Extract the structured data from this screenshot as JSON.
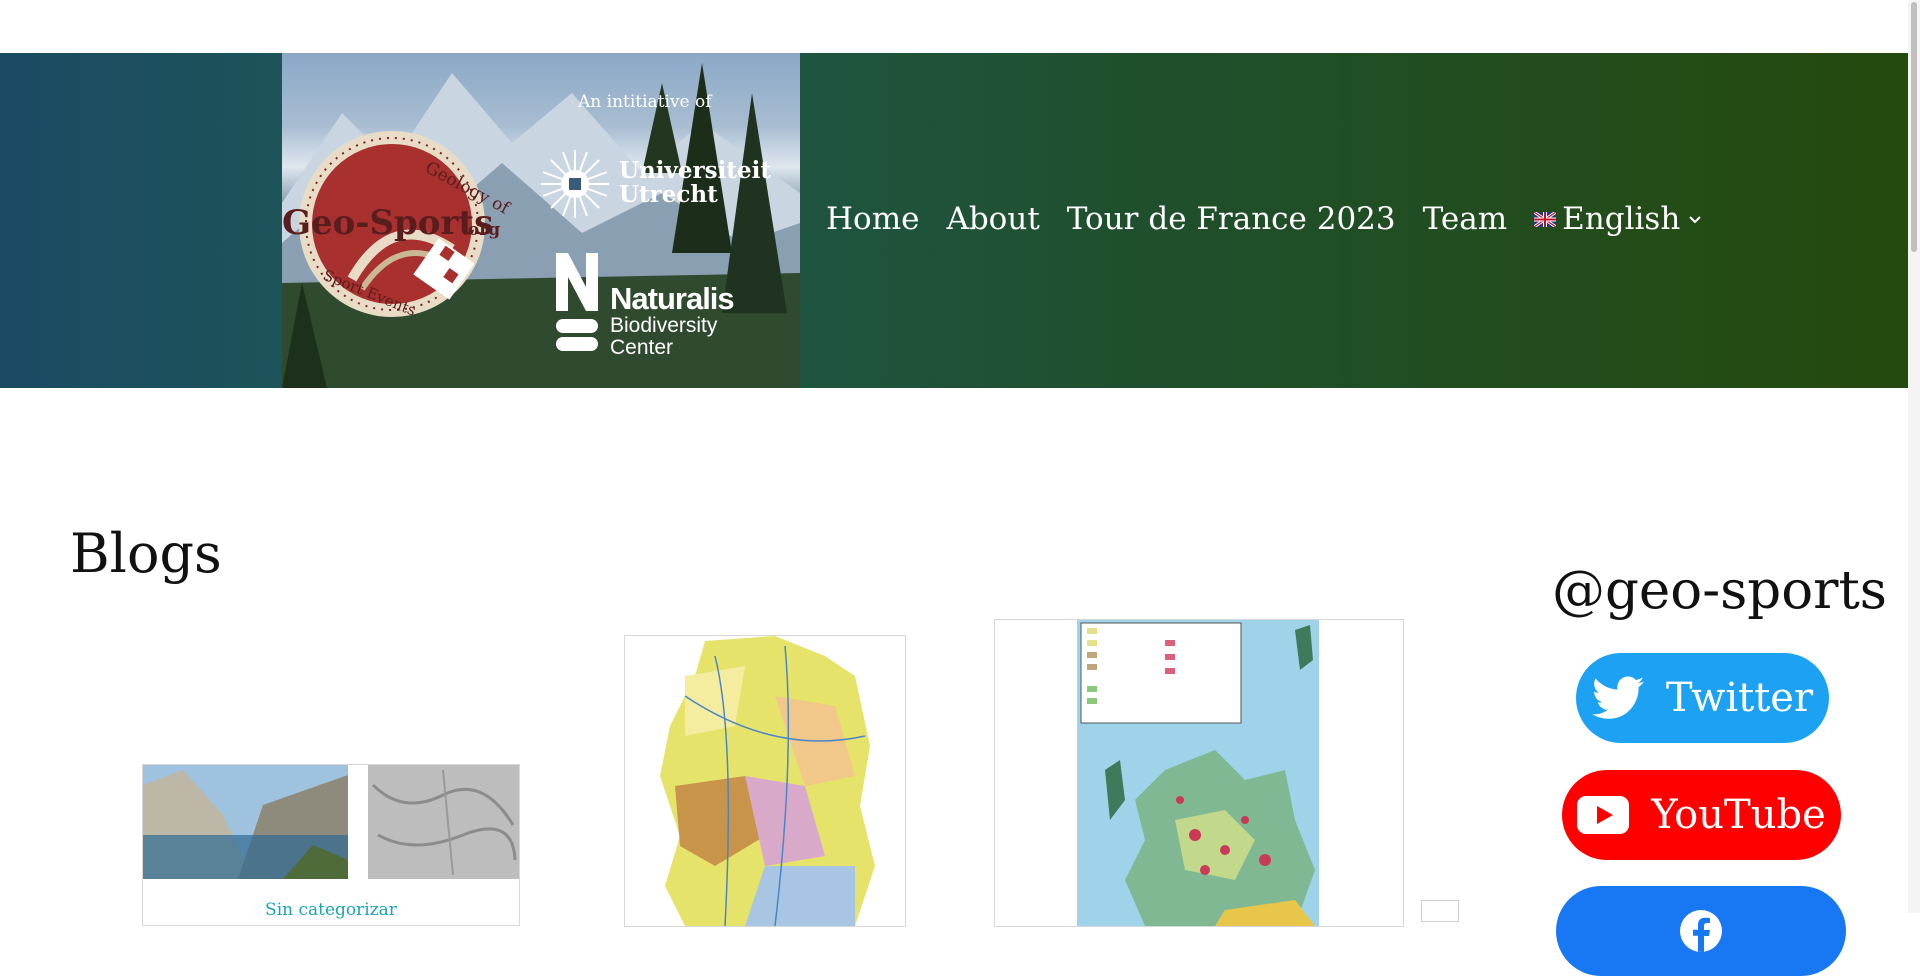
{
  "header": {
    "initiative_text": "An intitiative of",
    "geo_badge": {
      "brand": "Geo-Sports",
      "tld": ".org",
      "arc_top": "Geology of",
      "arc_bottom": "Sport Events"
    },
    "uu": {
      "line1": "Universiteit",
      "line2": "Utrecht"
    },
    "naturalis": {
      "name": "Naturalis",
      "line1": "Biodiversity",
      "line2": "Center"
    }
  },
  "nav": {
    "items": [
      "Home",
      "About",
      "Tour de France 2023",
      "Team"
    ],
    "language": "English",
    "icons": {
      "flag": "uk-flag-icon",
      "chevron": "chevron-down-icon"
    }
  },
  "main": {
    "title": "Blogs",
    "cards": [
      {
        "category": "Sin categorizar"
      }
    ]
  },
  "sidebar": {
    "handle": "@geo-sports",
    "social": [
      {
        "label": "Twitter",
        "icon": "twitter-icon",
        "color": "#1da1f2"
      },
      {
        "label": "YouTube",
        "icon": "youtube-icon",
        "color": "#ff0000"
      },
      {
        "label": "",
        "icon": "facebook-icon",
        "color": "#1877f2"
      }
    ]
  },
  "colors": {
    "header_start": "#1b4a63",
    "header_end": "#254a0e",
    "link_teal": "#1aa4b8"
  }
}
